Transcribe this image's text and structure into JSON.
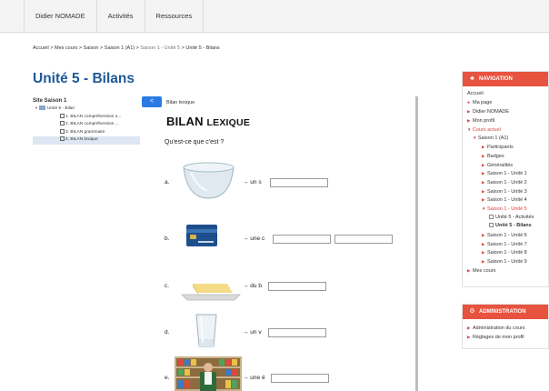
{
  "topnav": {
    "items": [
      "Didier NOMADE",
      "Activités",
      "Ressources"
    ]
  },
  "breadcrumb": {
    "home": "Accueil",
    "sep": ">",
    "courses": "Mes cours",
    "saison": "Saison",
    "saison1": "Saison 1 (A1)",
    "unite5": "Saison 1 - Unité 5",
    "current": "Unité 5 - Bilans"
  },
  "page": {
    "title": "Unité 5 - Bilans"
  },
  "tree": {
    "head": "Site Saison 1",
    "items": [
      {
        "label": "Unité 5 - Bilan"
      },
      {
        "label": "1. BILAN compréhension o..."
      },
      {
        "label": "2. BILAN compréhension ..."
      },
      {
        "label": "3. BILAN grammaire"
      },
      {
        "label": "4. BILAN lexique"
      }
    ]
  },
  "frame": {
    "collapse_label": "<",
    "crumb": "Bilan lexique",
    "title_big": "BILAN",
    "title_small": "LEXIQUE",
    "question": "Qu'est-ce que c'est ?",
    "exercises": [
      {
        "label": "a.",
        "text": "→ un s",
        "image": "glass-bowl"
      },
      {
        "label": "b.",
        "text": "→ une c",
        "image": "bank-card"
      },
      {
        "label": "c.",
        "text": "→ du b",
        "image": "butter"
      },
      {
        "label": "d.",
        "text": "→ un v",
        "image": "drinking-glass"
      },
      {
        "label": "e.",
        "text": "→ une é",
        "image": "grocery-shelf"
      }
    ]
  },
  "navigation": {
    "title": "NAVIGATION",
    "items": [
      {
        "label": "Accueil",
        "marker": ""
      },
      {
        "label": "Ma page",
        "marker": "dot"
      },
      {
        "label": "Didier NOMADE",
        "marker": "arrow"
      },
      {
        "label": "Mon profil",
        "marker": "arrow"
      },
      {
        "label": "Cours actuel",
        "marker": "open"
      },
      {
        "label": "Saison 1 (A1)",
        "marker": "open"
      },
      {
        "label": "Participants",
        "marker": "arrow"
      },
      {
        "label": "Badges",
        "marker": "arrow"
      },
      {
        "label": "Généralités",
        "marker": "arrow"
      },
      {
        "label": "Saison 1 - Unité 1",
        "marker": "arrow"
      },
      {
        "label": "Saison 1 - Unité 2",
        "marker": "arrow"
      },
      {
        "label": "Saison 1 - Unité 3",
        "marker": "arrow"
      },
      {
        "label": "Saison 1 - Unité 4",
        "marker": "arrow"
      },
      {
        "label": "Saison 1 - Unité 5",
        "marker": "open"
      },
      {
        "label": "Unité 5 - Activités",
        "marker": "activity"
      },
      {
        "label": "Unité 5 - Bilans",
        "marker": "activity"
      },
      {
        "label": "Saison 1 - Unité 6",
        "marker": "arrow"
      },
      {
        "label": "Saison 1 - Unité 7",
        "marker": "arrow"
      },
      {
        "label": "Saison 1 - Unité 8",
        "marker": "arrow"
      },
      {
        "label": "Saison 1 - Unité 9",
        "marker": "arrow"
      },
      {
        "label": "Mes cours",
        "marker": "arrow"
      }
    ]
  },
  "administration": {
    "title": "ADMINISTRATION",
    "items": [
      {
        "label": "Administration du cours"
      },
      {
        "label": "Réglages de mon profil"
      }
    ]
  },
  "colors": {
    "accent_red": "#e8533f",
    "title_blue": "#1e5a96",
    "button_blue": "#2c7be5"
  }
}
